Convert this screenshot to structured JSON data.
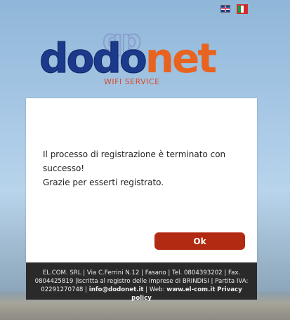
{
  "languages": [
    {
      "code": "en",
      "icon": "uk-flag-icon"
    },
    {
      "code": "it",
      "icon": "italy-flag-icon",
      "selected": true
    }
  ],
  "logo": {
    "mark": "qp",
    "word_part1": "dodo",
    "word_part2": "net",
    "subtitle": "WIFI SERVICE"
  },
  "message": {
    "line1": "Il processo di registrazione è terminato con successo!",
    "line2": "Grazie per esserti registrato."
  },
  "ok_button": "Ok",
  "footer": {
    "line1": "EL.COM. SRL | Via C.Ferrini N.12 | Fasano | Tel. 0804393202 | Fax.",
    "line2": "0804425819 |Iscritta al registro delle imprese di BRINDISI | Partita IVA:",
    "line3_prefix": "02291270748 | ",
    "email": "info@dodonet.it",
    "web_sep": " | Web: ",
    "website": "www.el-com.it",
    "privacy": "Privacy policy"
  },
  "colors": {
    "accent": "#b12a11",
    "logo_blue": "#1c3a8c",
    "logo_orange": "#e8631f",
    "footer_bg": "#2a2a2a"
  }
}
